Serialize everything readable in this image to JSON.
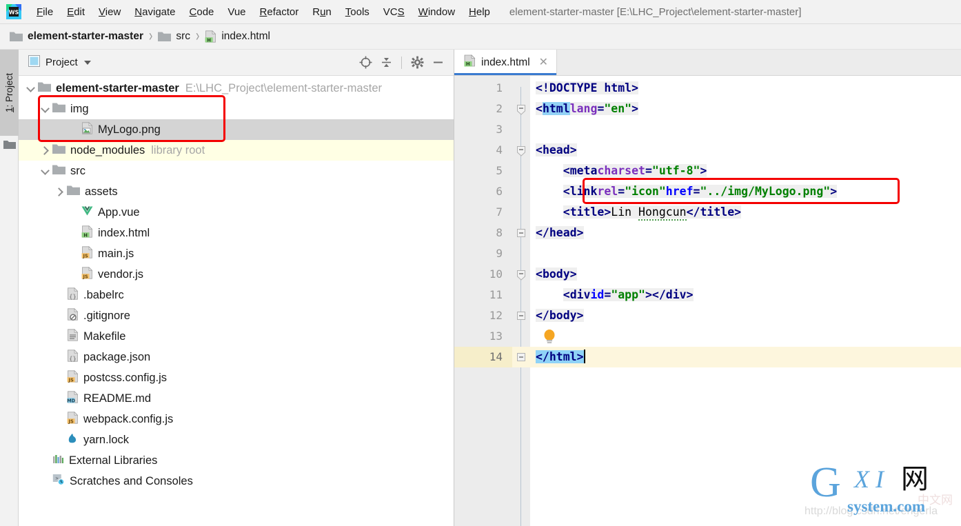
{
  "titlebar": {
    "logo_icon": "webstorm-logo-icon",
    "menus": [
      {
        "pre": "",
        "mn": "F",
        "post": "ile"
      },
      {
        "pre": "",
        "mn": "E",
        "post": "dit"
      },
      {
        "pre": "",
        "mn": "V",
        "post": "iew"
      },
      {
        "pre": "",
        "mn": "N",
        "post": "avigate"
      },
      {
        "pre": "",
        "mn": "C",
        "post": "ode"
      },
      {
        "pre": "Vue",
        "mn": "",
        "post": ""
      },
      {
        "pre": "",
        "mn": "R",
        "post": "efactor"
      },
      {
        "pre": "R",
        "mn": "u",
        "post": "n"
      },
      {
        "pre": "",
        "mn": "T",
        "post": "ools"
      },
      {
        "pre": "VC",
        "mn": "S",
        "post": ""
      },
      {
        "pre": "",
        "mn": "W",
        "post": "indow"
      },
      {
        "pre": "",
        "mn": "H",
        "post": "elp"
      }
    ],
    "window_title": "element-starter-master [E:\\LHC_Project\\element-starter-master]"
  },
  "breadcrumb": {
    "items": [
      {
        "label": "element-starter-master",
        "icon": "folder-icon",
        "bold": true
      },
      {
        "label": "src",
        "icon": "folder-icon",
        "bold": false
      },
      {
        "label": "index.html",
        "icon": "html-file-icon",
        "bold": false
      }
    ],
    "separator": "›"
  },
  "tool_rail": {
    "tab_pre": "1: Project",
    "tab_mn": "1",
    "tab_post": ": Project",
    "folder_icon": "folder-icon"
  },
  "project_panel": {
    "title": "Project",
    "title_icon": "project-view-icon",
    "caret_icon": "chevron-down-icon",
    "tools": [
      {
        "name": "locate-file-icon"
      },
      {
        "name": "collapse-all-icon"
      },
      {
        "name": "gear-icon"
      },
      {
        "name": "minimize-icon"
      }
    ]
  },
  "tree": {
    "rows": [
      {
        "label": "element-starter-master",
        "note": "E:\\LHC_Project\\element-starter-master",
        "icon": "folder-icon",
        "arrow": "open",
        "indent": 0,
        "bold": true,
        "state": "normal"
      },
      {
        "label": "img",
        "note": "",
        "icon": "folder-icon",
        "arrow": "open",
        "indent": 1,
        "bold": false,
        "state": "normal"
      },
      {
        "label": "MyLogo.png",
        "note": "",
        "icon": "image-file-icon",
        "arrow": "none",
        "indent": 3,
        "bold": false,
        "state": "selected"
      },
      {
        "label": "node_modules",
        "note": "library root",
        "icon": "folder-icon",
        "arrow": "closed",
        "indent": 1,
        "bold": false,
        "state": "library"
      },
      {
        "label": "src",
        "note": "",
        "icon": "folder-icon",
        "arrow": "open",
        "indent": 1,
        "bold": false,
        "state": "normal"
      },
      {
        "label": "assets",
        "note": "",
        "icon": "folder-icon",
        "arrow": "closed",
        "indent": 2,
        "bold": false,
        "state": "normal"
      },
      {
        "label": "App.vue",
        "note": "",
        "icon": "vue-file-icon",
        "arrow": "none",
        "indent": 3,
        "bold": false,
        "state": "normal"
      },
      {
        "label": "index.html",
        "note": "",
        "icon": "html-file-icon",
        "arrow": "none",
        "indent": 3,
        "bold": false,
        "state": "normal"
      },
      {
        "label": "main.js",
        "note": "",
        "icon": "js-file-icon",
        "arrow": "none",
        "indent": 3,
        "bold": false,
        "state": "normal"
      },
      {
        "label": "vendor.js",
        "note": "",
        "icon": "js-file-icon",
        "arrow": "none",
        "indent": 3,
        "bold": false,
        "state": "normal"
      },
      {
        "label": ".babelrc",
        "note": "",
        "icon": "json-file-icon",
        "arrow": "none",
        "indent": 2,
        "bold": false,
        "state": "normal"
      },
      {
        "label": ".gitignore",
        "note": "",
        "icon": "gitignore-file-icon",
        "arrow": "none",
        "indent": 2,
        "bold": false,
        "state": "normal"
      },
      {
        "label": "Makefile",
        "note": "",
        "icon": "text-file-icon",
        "arrow": "none",
        "indent": 2,
        "bold": false,
        "state": "normal"
      },
      {
        "label": "package.json",
        "note": "",
        "icon": "json-file-icon",
        "arrow": "none",
        "indent": 2,
        "bold": false,
        "state": "normal"
      },
      {
        "label": "postcss.config.js",
        "note": "",
        "icon": "js-file-icon",
        "arrow": "none",
        "indent": 2,
        "bold": false,
        "state": "normal"
      },
      {
        "label": "README.md",
        "note": "",
        "icon": "md-file-icon",
        "arrow": "none",
        "indent": 2,
        "bold": false,
        "state": "normal"
      },
      {
        "label": "webpack.config.js",
        "note": "",
        "icon": "js-file-icon",
        "arrow": "none",
        "indent": 2,
        "bold": false,
        "state": "normal"
      },
      {
        "label": "yarn.lock",
        "note": "",
        "icon": "yarn-file-icon",
        "arrow": "none",
        "indent": 2,
        "bold": false,
        "state": "normal"
      },
      {
        "label": "External Libraries",
        "note": "",
        "icon": "external-libraries-icon",
        "arrow": "none",
        "indent": 1,
        "bold": false,
        "state": "normal"
      },
      {
        "label": "Scratches and Consoles",
        "note": "",
        "icon": "scratches-icon",
        "arrow": "none",
        "indent": 1,
        "bold": false,
        "state": "normal"
      }
    ]
  },
  "editor": {
    "tab": {
      "label": "index.html",
      "icon": "html-file-icon",
      "close_icon": "close-icon"
    },
    "line_numbers": [
      "1",
      "2",
      "3",
      "4",
      "5",
      "6",
      "7",
      "8",
      "9",
      "10",
      "11",
      "12",
      "13",
      "14"
    ],
    "current_line": 14,
    "bulb_icon": "intention-bulb-icon",
    "bulb_line": 13,
    "fold_lines": [
      2,
      4,
      8,
      10,
      12,
      14
    ],
    "lines": [
      {
        "n": 1,
        "text": "<!DOCTYPE html>"
      },
      {
        "n": 2,
        "text": "<html lang=\"en\">"
      },
      {
        "n": 3,
        "text": ""
      },
      {
        "n": 4,
        "text": "<head>"
      },
      {
        "n": 5,
        "text": "    <meta charset=\"utf-8\">"
      },
      {
        "n": 6,
        "text": "    <link rel=\"icon\" href=\"../img/MyLogo.png\">"
      },
      {
        "n": 7,
        "text": "    <title>Lin Hongcun</title>"
      },
      {
        "n": 8,
        "text": "</head>"
      },
      {
        "n": 9,
        "text": ""
      },
      {
        "n": 10,
        "text": "<body>"
      },
      {
        "n": 11,
        "text": "    <div id=\"app\"></div>"
      },
      {
        "n": 12,
        "text": "</body>"
      },
      {
        "n": 13,
        "text": ""
      },
      {
        "n": 14,
        "text": "</html>"
      }
    ]
  },
  "annotations": {
    "tree_box_label": "highlight-img-mylogo",
    "code_box_label": "highlight-link-icon-line"
  },
  "watermark": {
    "g": "G",
    "xi": "X I",
    "cn": "网",
    "system": "system.com",
    "url": "http://blog.csdn.net/engerla",
    "ghost": "中文网"
  },
  "colors": {
    "accent_blue": "#3a7bd0",
    "annotation_red": "#f40000",
    "selection_gray": "#d4d4d4",
    "library_yellow": "#ffffe4",
    "current_line_yellow": "#fdf6dd",
    "tag_navy": "#000080",
    "string_green": "#008000",
    "attr_purple": "#7a2fbd"
  }
}
